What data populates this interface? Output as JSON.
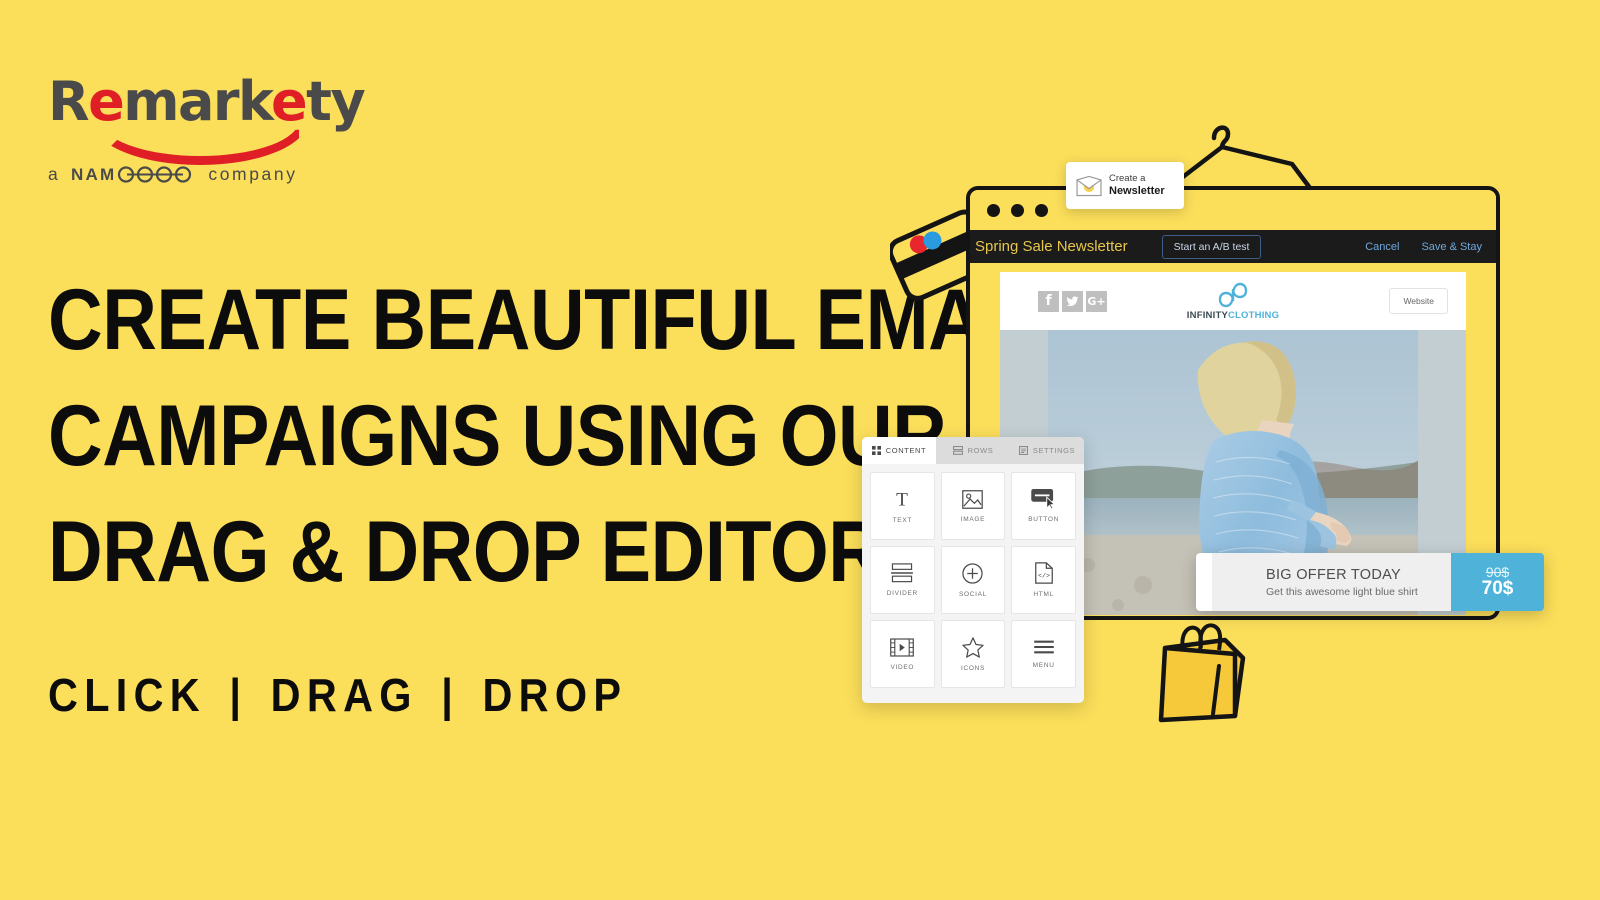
{
  "theme": {
    "background": "#FBDE5A",
    "ink": "#0C0C0C",
    "brand_red": "#E01E26",
    "accent_blue": "#4FB3D9",
    "dark_bar": "#1B1B1B",
    "bar_yellow_text": "#E6C64B",
    "bar_link_blue": "#6FA8DC"
  },
  "logo": {
    "word_part1": "R",
    "word_part2": "e",
    "word_part3": "mark",
    "word_part4": "e",
    "word_part5": "ty",
    "full_word": "Remarkety",
    "tagline_prefix": "a",
    "tagline_brand": "NAMOGOO",
    "tagline_suffix": "company",
    "tagline_full": "a NAMOGOO company"
  },
  "headline": {
    "line1": "CREATE BEAUTIFUL EMAIL",
    "line2": "CAMPAIGNS USING OUR",
    "line3": "DRAG & DROP EDITOR"
  },
  "actions": {
    "click": "CLICK",
    "drag": "DRAG",
    "drop": "DROP",
    "separator": "|"
  },
  "newsletter_card": {
    "line1": "Create a",
    "line2": "Newsletter",
    "icon": "envelope-icon"
  },
  "browser": {
    "dots": [
      "dot-red",
      "dot-yellow",
      "dot-green"
    ],
    "editor_bar": {
      "campaign_title": "Spring Sale Newsletter",
      "ab_test_button": "Start an A/B test",
      "cancel_link": "Cancel",
      "save_link": "Save & Stay"
    },
    "email": {
      "social_icons": [
        {
          "name": "facebook-icon",
          "glyph": "f"
        },
        {
          "name": "twitter-icon",
          "glyph": "t"
        },
        {
          "name": "googleplus-icon",
          "glyph": "G+"
        }
      ],
      "brand_logo_icon": "infinity-icon",
      "brand_name_dark": "INFINITY",
      "brand_name_blue": "CLOTHING",
      "website_button": "Website",
      "hero_alt": "woman in light blue knit sweater on a beach"
    }
  },
  "panel": {
    "tabs": [
      {
        "label": "CONTENT",
        "icon": "grid-icon",
        "active": true
      },
      {
        "label": "ROWS",
        "icon": "rows-icon",
        "active": false
      },
      {
        "label": "SETTINGS",
        "icon": "settings-icon",
        "active": false
      }
    ],
    "blocks": [
      {
        "label": "TEXT",
        "icon": "text-icon"
      },
      {
        "label": "IMAGE",
        "icon": "image-icon"
      },
      {
        "label": "BUTTON",
        "icon": "button-icon"
      },
      {
        "label": "DIVIDER",
        "icon": "divider-icon"
      },
      {
        "label": "SOCIAL",
        "icon": "social-plus-icon"
      },
      {
        "label": "HTML",
        "icon": "html-code-icon"
      },
      {
        "label": "VIDEO",
        "icon": "video-icon"
      },
      {
        "label": "ICONS",
        "icon": "star-icon"
      },
      {
        "label": "MENU",
        "icon": "menu-icon"
      }
    ]
  },
  "offer": {
    "title": "BIG OFFER TODAY",
    "subtitle": "Get this awesome light blue shirt",
    "price_old": "90$",
    "price_new": "70$"
  },
  "decor": {
    "hanger": "clothes-hanger-illustration",
    "shopping_bag": "shopping-bag-illustration",
    "credit_card": "credit-card-illustration"
  }
}
